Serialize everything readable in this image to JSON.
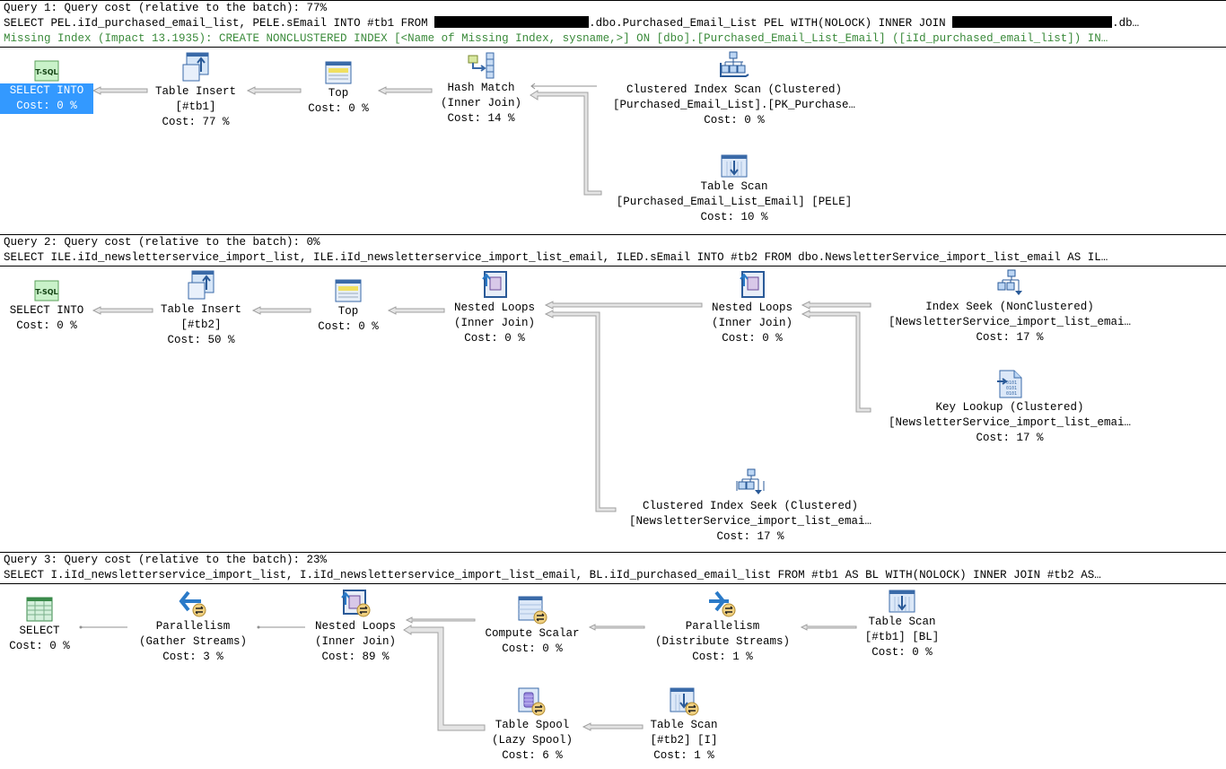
{
  "queries": [
    {
      "header": "Query 1: Query cost (relative to the batch): 77%",
      "sql_part1": "SELECT PEL.iId_purchased_email_list, PELE.sEmail INTO #tb1 FROM ",
      "sql_part2": ".dbo.Purchased_Email_List PEL WITH(NOLOCK) INNER JOIN ",
      "sql_part3": ".db…",
      "missing_index": "Missing Index (Impact 13.1935): CREATE NONCLUSTERED INDEX [<Name of Missing Index, sysname,>] ON [dbo].[Purchased_Email_List_Email] ([iId_purchased_email_list]) IN…",
      "nodes": [
        {
          "icon": "tsql-icon",
          "l1": "SELECT INTO",
          "l2": "Cost: 0 %",
          "l3": ""
        },
        {
          "icon": "table-insert-icon",
          "l1": "Table Insert",
          "l2": "[#tb1]",
          "l3": "Cost: 77 %"
        },
        {
          "icon": "top-icon",
          "l1": "Top",
          "l2": "Cost: 0 %",
          "l3": ""
        },
        {
          "icon": "hash-match-icon",
          "l1": "Hash Match",
          "l2": "(Inner Join)",
          "l3": "Cost: 14 %"
        },
        {
          "icon": "clustered-index-scan-icon",
          "l1": "Clustered Index Scan (Clustered)",
          "l2": "[Purchased_Email_List].[PK_Purchase…",
          "l3": "Cost: 0 %"
        },
        {
          "icon": "table-scan-icon",
          "l1": "Table Scan",
          "l2": "[Purchased_Email_List_Email] [PELE]",
          "l3": "Cost: 10 %"
        }
      ]
    },
    {
      "header": "Query 2: Query cost (relative to the batch): 0%",
      "sql": "SELECT ILE.iId_newsletterservice_import_list, ILE.iId_newsletterservice_import_list_email, ILED.sEmail INTO #tb2 FROM dbo.NewsletterService_import_list_email AS IL…",
      "nodes": [
        {
          "icon": "tsql-icon",
          "l1": "SELECT INTO",
          "l2": "Cost: 0 %",
          "l3": ""
        },
        {
          "icon": "table-insert-icon",
          "l1": "Table Insert",
          "l2": "[#tb2]",
          "l3": "Cost: 50 %"
        },
        {
          "icon": "top-icon",
          "l1": "Top",
          "l2": "Cost: 0 %",
          "l3": ""
        },
        {
          "icon": "nested-loops-icon",
          "l1": "Nested Loops",
          "l2": "(Inner Join)",
          "l3": "Cost: 0 %"
        },
        {
          "icon": "nested-loops-icon",
          "l1": "Nested Loops",
          "l2": "(Inner Join)",
          "l3": "Cost: 0 %"
        },
        {
          "icon": "index-seek-icon",
          "l1": "Index Seek (NonClustered)",
          "l2": "[NewsletterService_import_list_emai…",
          "l3": "Cost: 17 %"
        },
        {
          "icon": "key-lookup-icon",
          "l1": "Key Lookup (Clustered)",
          "l2": "[NewsletterService_import_list_emai…",
          "l3": "Cost: 17 %"
        },
        {
          "icon": "clustered-index-seek-icon",
          "l1": "Clustered Index Seek (Clustered)",
          "l2": "[NewsletterService_import_list_emai…",
          "l3": "Cost: 17 %"
        }
      ]
    },
    {
      "header": "Query 3: Query cost (relative to the batch): 23%",
      "sql": "SELECT I.iId_newsletterservice_import_list, I.iId_newsletterservice_import_list_email, BL.iId_purchased_email_list FROM #tb1 AS BL WITH(NOLOCK) INNER JOIN #tb2 AS…",
      "nodes": [
        {
          "icon": "select-icon",
          "l1": "SELECT",
          "l2": "Cost: 0 %",
          "l3": ""
        },
        {
          "icon": "parallelism-gather-icon",
          "l1": "Parallelism",
          "l2": "(Gather Streams)",
          "l3": "Cost: 3 %"
        },
        {
          "icon": "nested-loops-parallel-icon",
          "l1": "Nested Loops",
          "l2": "(Inner Join)",
          "l3": "Cost: 89 %"
        },
        {
          "icon": "compute-scalar-icon",
          "l1": "Compute Scalar",
          "l2": "Cost: 0 %",
          "l3": ""
        },
        {
          "icon": "parallelism-distribute-icon",
          "l1": "Parallelism",
          "l2": "(Distribute Streams)",
          "l3": "Cost: 1 %"
        },
        {
          "icon": "table-scan-icon",
          "l1": "Table Scan",
          "l2": "[#tb1] [BL]",
          "l3": "Cost: 0 %"
        },
        {
          "icon": "table-spool-icon",
          "l1": "Table Spool",
          "l2": "(Lazy Spool)",
          "l3": "Cost: 6 %"
        },
        {
          "icon": "table-scan-parallel-icon",
          "l1": "Table Scan",
          "l2": "[#tb2] [I]",
          "l3": "Cost: 1 %"
        }
      ]
    }
  ],
  "colors": {
    "selection": "#3399ff",
    "missing_index_text": "#3a8a3a",
    "arrow_fill": "#e4e4e4",
    "arrow_stroke": "#a0a0a0"
  }
}
